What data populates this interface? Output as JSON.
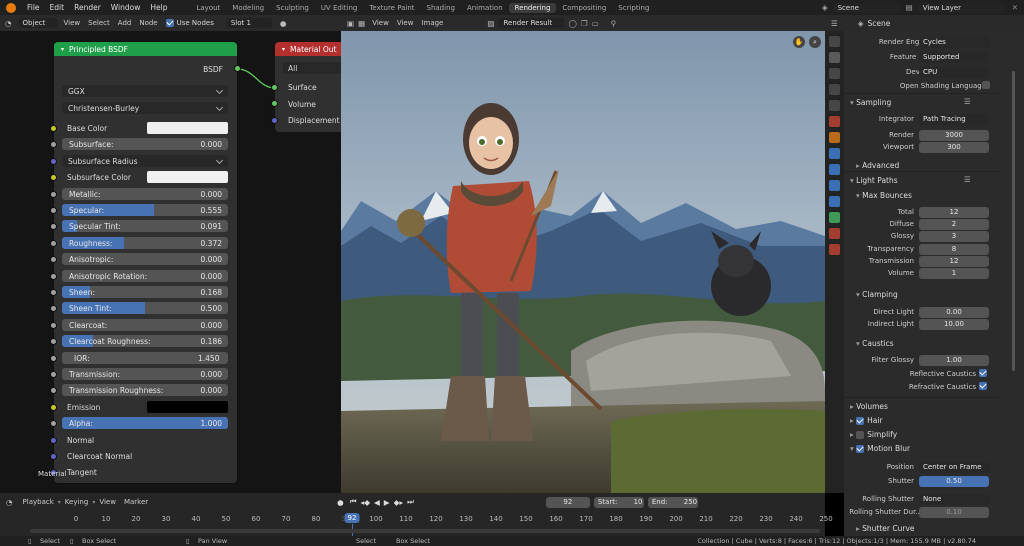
{
  "menu": {
    "items": [
      "File",
      "Edit",
      "Render",
      "Window",
      "Help"
    ],
    "workspaces": [
      "Layout",
      "Modeling",
      "Sculpting",
      "UV Editing",
      "Texture Paint",
      "Shading",
      "Animation",
      "Rendering",
      "Compositing",
      "Scripting"
    ],
    "active_workspace": "Rendering",
    "scene": "Scene",
    "view_layer": "View Layer"
  },
  "node_header": {
    "object_mode": "Object",
    "items": [
      "View",
      "Select",
      "Add",
      "Node"
    ],
    "use_nodes": "Use Nodes",
    "slot": "Slot 1"
  },
  "render_header": {
    "items": [
      "View",
      "View",
      "Image"
    ],
    "render_result": "Render Result"
  },
  "bsdf": {
    "title": "Principled BSDF",
    "output": "BSDF",
    "dist": "GGX",
    "sss": "Christensen-Burley",
    "rows": [
      {
        "kind": "color",
        "label": "Base Color",
        "color": "#f0f0f0",
        "sock": "col"
      },
      {
        "kind": "field",
        "label": "Subsurface:",
        "value": "0.000",
        "fill": 0,
        "sock": "flt"
      },
      {
        "kind": "select",
        "label": "Subsurface Radius",
        "sock": "vec"
      },
      {
        "kind": "color",
        "label": "Subsurface Color",
        "color": "#f0f0f0",
        "sock": "col"
      },
      {
        "kind": "field",
        "label": "Metallic:",
        "value": "0.000",
        "fill": 0,
        "sock": "flt"
      },
      {
        "kind": "field",
        "label": "Specular:",
        "value": "0.555",
        "fill": 0.555,
        "sock": "flt"
      },
      {
        "kind": "field",
        "label": "Specular Tint:",
        "value": "0.091",
        "fill": 0.091,
        "sock": "flt"
      },
      {
        "kind": "field",
        "label": "Roughness:",
        "value": "0.372",
        "fill": 0.372,
        "sock": "flt"
      },
      {
        "kind": "field",
        "label": "Anisotropic:",
        "value": "0.000",
        "fill": 0,
        "sock": "flt"
      },
      {
        "kind": "field",
        "label": "Anisotropic Rotation:",
        "value": "0.000",
        "fill": 0,
        "sock": "flt"
      },
      {
        "kind": "field",
        "label": "Sheen:",
        "value": "0.168",
        "fill": 0.168,
        "sock": "flt"
      },
      {
        "kind": "field",
        "label": "Sheen Tint:",
        "value": "0.500",
        "fill": 0.5,
        "sock": "flt"
      },
      {
        "kind": "field",
        "label": "Clearcoat:",
        "value": "0.000",
        "fill": 0,
        "sock": "flt"
      },
      {
        "kind": "field",
        "label": "Clearcoat Roughness:",
        "value": "0.186",
        "fill": 0.186,
        "sock": "flt"
      },
      {
        "kind": "field",
        "label": "IOR:",
        "value": "1.450",
        "fill": 0,
        "sock": "flt",
        "center": true
      },
      {
        "kind": "field",
        "label": "Transmission:",
        "value": "0.000",
        "fill": 0,
        "sock": "flt"
      },
      {
        "kind": "field",
        "label": "Transmission Roughness:",
        "value": "0.000",
        "fill": 0,
        "sock": "flt"
      },
      {
        "kind": "color",
        "label": "Emission",
        "color": "#000000",
        "sock": "col"
      },
      {
        "kind": "field",
        "label": "Alpha:",
        "value": "1.000",
        "fill": 1,
        "sock": "flt"
      },
      {
        "kind": "text",
        "label": "Normal",
        "sock": "vec"
      },
      {
        "kind": "text",
        "label": "Clearcoat Normal",
        "sock": "vec"
      },
      {
        "kind": "text",
        "label": "Tangent",
        "sock": "vec"
      }
    ]
  },
  "matout": {
    "title": "Material Out",
    "target": "All",
    "inputs": [
      "Surface",
      "Volume",
      "Displacement"
    ]
  },
  "material_label": "Material",
  "props": {
    "tab_label": "Scene",
    "render_engine_label": "Render Engine",
    "render_engine": "Cycles",
    "feature_set_label": "Feature Set",
    "feature_set": "Supported",
    "device_label": "Device",
    "device": "CPU",
    "osl_label": "Open Shading Language",
    "sampling": "Sampling",
    "integrator_label": "Integrator",
    "integrator": "Path Tracing",
    "render_label": "Render",
    "render_samples": "3000",
    "viewport_label": "Viewport",
    "viewport_samples": "300",
    "advanced": "Advanced",
    "light_paths": "Light Paths",
    "max_bounces": "Max Bounces",
    "bounces": [
      [
        "Total",
        "12"
      ],
      [
        "Diffuse",
        "2"
      ],
      [
        "Glossy",
        "3"
      ],
      [
        "Transparency",
        "8"
      ],
      [
        "Transmission",
        "12"
      ],
      [
        "Volume",
        "1"
      ]
    ],
    "clamping": "Clamping",
    "clamp": [
      [
        "Direct Light",
        "0.00"
      ],
      [
        "Indirect Light",
        "10.00"
      ]
    ],
    "caustics": "Caustics",
    "filter_glossy_label": "Filter Glossy",
    "filter_glossy": "1.00",
    "refl_caustics": "Reflective Caustics",
    "refr_caustics": "Refractive Caustics",
    "volumes": "Volumes",
    "hair": "Hair",
    "simplify": "Simplify",
    "motion_blur": "Motion Blur",
    "position_label": "Position",
    "position": "Center on Frame",
    "shutter_label": "Shutter",
    "shutter": "0.50",
    "rolling_label": "Rolling Shutter",
    "rolling": "None",
    "rolling_dur_label": "Rolling Shutter Dur...",
    "rolling_dur": "0.10",
    "shutter_curve": "Shutter Curve"
  },
  "timeline": {
    "items": [
      "Playback",
      "Keying",
      "View",
      "Marker"
    ],
    "current_frame": "92",
    "start_label": "Start:",
    "start": "10",
    "end_label": "End:",
    "end": "250",
    "ticks": [
      "0",
      "10",
      "20",
      "30",
      "40",
      "50",
      "60",
      "70",
      "80",
      "90",
      "100",
      "110",
      "120",
      "130",
      "140",
      "150",
      "160",
      "170",
      "180",
      "190",
      "200",
      "210",
      "220",
      "230",
      "240",
      "250"
    ]
  },
  "status": {
    "select": "Select",
    "box_select": "Box Select",
    "pan_view": "Pan View",
    "select2": "Select",
    "box_select2": "Box Select",
    "info": "Collection | Cube | Verts:8 | Faces:6 | Tris:12 | Objects:1/3 | Mem: 155.9 MB | v2.80.74"
  },
  "colors": {
    "accent": "#4772b3",
    "node_header_green": "#1f9f4a",
    "node_header_red": "#b3302f",
    "viewport_bg": "#1d1d1d"
  }
}
